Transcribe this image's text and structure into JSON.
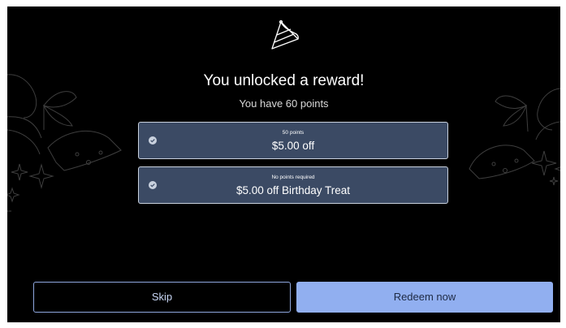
{
  "reward_screen": {
    "title": "You unlocked a reward!",
    "subtitle": "You have 60 points",
    "icon": "party-hat-icon",
    "rewards": [
      {
        "caption": "50 points",
        "label": "$5.00 off",
        "icon": "check-circle-icon"
      },
      {
        "caption": "No points required",
        "label": "$5.00 off Birthday Treat",
        "icon": "check-circle-icon"
      }
    ]
  },
  "actions": {
    "skip_label": "Skip",
    "redeem_label": "Redeem now"
  },
  "colors": {
    "background": "#000000",
    "reward_card": "#3b4a64",
    "accent": "#91aff0"
  }
}
